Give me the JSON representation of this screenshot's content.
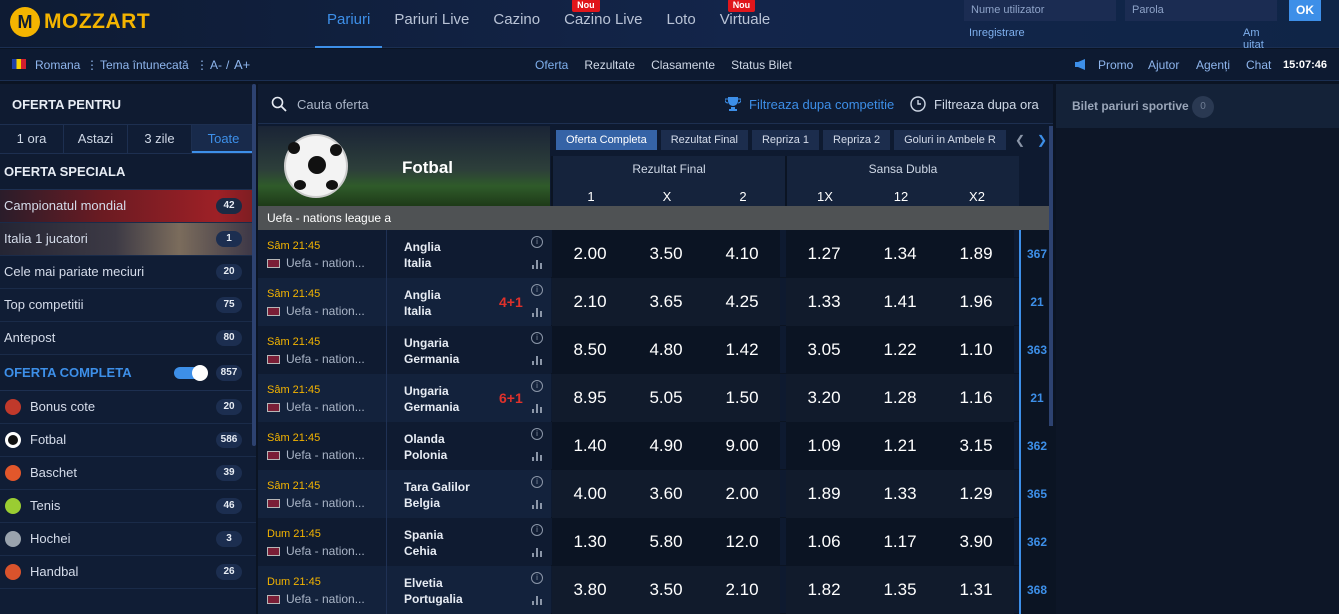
{
  "brand": {
    "name": "MOZZART",
    "badge": "M"
  },
  "nav": {
    "items": [
      {
        "label": "Pariuri",
        "active": true,
        "nou": false
      },
      {
        "label": "Pariuri Live",
        "active": false,
        "nou": false
      },
      {
        "label": "Cazino",
        "active": false,
        "nou": false
      },
      {
        "label": "Cazino Live",
        "active": false,
        "nou": true
      },
      {
        "label": "Loto",
        "active": false,
        "nou": false
      },
      {
        "label": "Virtuale",
        "active": false,
        "nou": true
      }
    ],
    "nou_label": "Nou"
  },
  "login": {
    "username_placeholder": "Nume utilizator",
    "password_placeholder": "Parola",
    "ok": "OK",
    "register": "Inregistrare",
    "forgot": "Am uitat parola"
  },
  "subbar": {
    "language": "Romana",
    "theme": "Tema întunecată",
    "font_small": "A-",
    "font_sep": "/",
    "font_big": "A+",
    "links": [
      "Oferta",
      "Rezultate",
      "Clasamente",
      "Status Bilet"
    ],
    "promo": "Promo",
    "help": "Ajutor",
    "agents": "Agenți",
    "chat": "Chat",
    "time": "15:07:46"
  },
  "sidebar": {
    "title": "OFERTA PENTRU",
    "tabs": [
      "1 ora",
      "Astazi",
      "3 zile",
      "Toate"
    ],
    "active_tab": "Toate",
    "special_title": "OFERTA SPECIALA",
    "special": [
      {
        "label": "Campionatul mondial",
        "count": "42"
      },
      {
        "label": "Italia 1 jucatori",
        "count": "1"
      },
      {
        "label": "Cele mai pariate meciuri",
        "count": "20"
      },
      {
        "label": "Top competitii",
        "count": "75"
      },
      {
        "label": "Antepost",
        "count": "80"
      }
    ],
    "complete_title": "OFERTA COMPLETA",
    "complete_count": "857",
    "sports": [
      {
        "label": "Bonus cote",
        "count": "20",
        "icon": "bonus-icon",
        "color": "#c0392b"
      },
      {
        "label": "Fotbal",
        "count": "586",
        "icon": "football-icon",
        "color": "#ffffff"
      },
      {
        "label": "Baschet",
        "count": "39",
        "icon": "basketball-icon",
        "color": "#e2572b"
      },
      {
        "label": "Tenis",
        "count": "46",
        "icon": "tennis-icon",
        "color": "#9acd32"
      },
      {
        "label": "Hochei",
        "count": "3",
        "icon": "hockey-icon",
        "color": "#9aa3ad"
      },
      {
        "label": "Handbal",
        "count": "26",
        "icon": "handball-icon",
        "color": "#d9532c"
      }
    ]
  },
  "search": {
    "placeholder": "Cauta oferta",
    "filter_comp": "Filtreaza dupa competitie",
    "filter_time": "Filtreaza dupa ora"
  },
  "sport": {
    "name": "Fotbal"
  },
  "market_tabs": [
    "Oferta Completa",
    "Rezultat Final",
    "Repriza 1",
    "Repriza 2",
    "Goluri in Ambele R"
  ],
  "groups": [
    {
      "title": "Rezultat Final",
      "cols": [
        "1",
        "X",
        "2"
      ]
    },
    {
      "title": "Sansa Dubla",
      "cols": [
        "1X",
        "12",
        "X2"
      ]
    }
  ],
  "league": "Uefa - nations league a",
  "matches": [
    {
      "time": "Sâm 21:45",
      "comp": "Uefa - nation...",
      "home": "Anglia",
      "away": "Italia",
      "live": "",
      "odds": [
        "2.00",
        "3.50",
        "4.10",
        "1.27",
        "1.34",
        "1.89"
      ],
      "more": "367"
    },
    {
      "time": "Sâm 21:45",
      "comp": "Uefa - nation...",
      "home": "Anglia",
      "away": "Italia",
      "live": "4+1",
      "odds": [
        "2.10",
        "3.65",
        "4.25",
        "1.33",
        "1.41",
        "1.96"
      ],
      "more": "21"
    },
    {
      "time": "Sâm 21:45",
      "comp": "Uefa - nation...",
      "home": "Ungaria",
      "away": "Germania",
      "live": "",
      "odds": [
        "8.50",
        "4.80",
        "1.42",
        "3.05",
        "1.22",
        "1.10"
      ],
      "more": "363"
    },
    {
      "time": "Sâm 21:45",
      "comp": "Uefa - nation...",
      "home": "Ungaria",
      "away": "Germania",
      "live": "6+1",
      "odds": [
        "8.95",
        "5.05",
        "1.50",
        "3.20",
        "1.28",
        "1.16"
      ],
      "more": "21"
    },
    {
      "time": "Sâm 21:45",
      "comp": "Uefa - nation...",
      "home": "Olanda",
      "away": "Polonia",
      "live": "",
      "odds": [
        "1.40",
        "4.90",
        "9.00",
        "1.09",
        "1.21",
        "3.15"
      ],
      "more": "362"
    },
    {
      "time": "Sâm 21:45",
      "comp": "Uefa - nation...",
      "home": "Tara Galilor",
      "away": "Belgia",
      "live": "",
      "odds": [
        "4.00",
        "3.60",
        "2.00",
        "1.89",
        "1.33",
        "1.29"
      ],
      "more": "365"
    },
    {
      "time": "Dum 21:45",
      "comp": "Uefa - nation...",
      "home": "Spania",
      "away": "Cehia",
      "live": "",
      "odds": [
        "1.30",
        "5.80",
        "12.0",
        "1.06",
        "1.17",
        "3.90"
      ],
      "more": "362"
    },
    {
      "time": "Dum 21:45",
      "comp": "Uefa - nation...",
      "home": "Elvetia",
      "away": "Portugalia",
      "live": "",
      "odds": [
        "3.80",
        "3.50",
        "2.10",
        "1.82",
        "1.35",
        "1.31"
      ],
      "more": "368"
    }
  ],
  "betslip": {
    "title": "Bilet pariuri sportive",
    "count": "0"
  }
}
